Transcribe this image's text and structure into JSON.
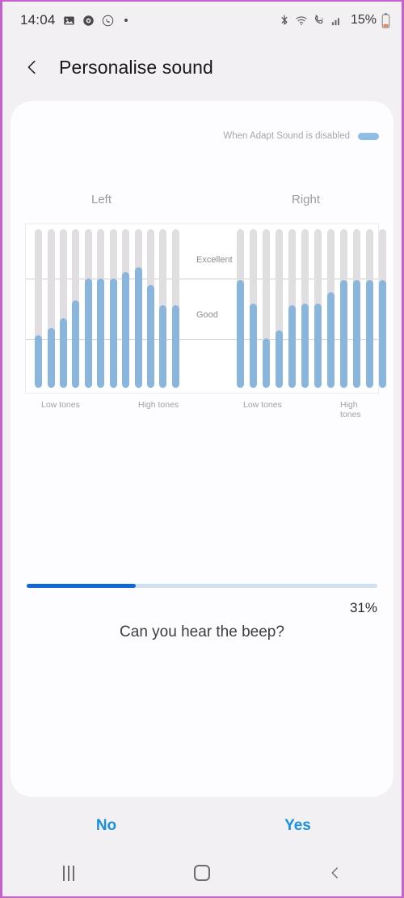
{
  "status_bar": {
    "time": "14:04",
    "left_icons": [
      "gallery-icon",
      "record-circle-icon",
      "whatsapp-icon",
      "dot-indicator"
    ],
    "right_icons": [
      "bluetooth-icon",
      "wifi-icon",
      "volte-call-icon",
      "signal-bars-icon"
    ],
    "battery_percent": "15%"
  },
  "app_bar": {
    "back_label": "back-chevron",
    "title": "Personalise sound"
  },
  "card": {
    "adapt_sound": {
      "label": "When Adapt Sound is disabled",
      "toggle_state": "on",
      "toggle_color": "#8fbde4"
    },
    "progress": {
      "percent_text": "31%",
      "percent_value": 31,
      "fill_color": "#1068d4",
      "track_color": "#cfe0f2"
    },
    "question": "Can you hear the beep?"
  },
  "answers": {
    "no_label": "No",
    "yes_label": "Yes",
    "color": "#1a91dc"
  },
  "nav_bar": {
    "recents_label": "recents-icon",
    "home_label": "home-icon",
    "back_label": "back-icon"
  },
  "chart_data": {
    "type": "bar",
    "title": "",
    "xlabel": "",
    "ylabel": "",
    "ylim": [
      0,
      100
    ],
    "grid": true,
    "grid_values": [
      68,
      32
    ],
    "quality_labels": [
      "Excellent",
      "Good"
    ],
    "tone_labels": [
      "Low tones",
      "High tones"
    ],
    "bar_track_color": "#e0dee1",
    "bar_fill_color": "#8ab6de",
    "panels": [
      {
        "name": "Left",
        "categories": [
          "f1",
          "f2",
          "f3",
          "f4",
          "f5",
          "f6",
          "f7",
          "f8",
          "f9",
          "f10",
          "f11",
          "f12"
        ],
        "values": [
          33,
          38,
          44,
          55,
          69,
          69,
          69,
          73,
          76,
          65,
          52,
          52
        ]
      },
      {
        "name": "Right",
        "categories": [
          "f1",
          "f2",
          "f3",
          "f4",
          "f5",
          "f6",
          "f7",
          "f8",
          "f9",
          "f10",
          "f11",
          "f12"
        ],
        "values": [
          68,
          53,
          31,
          36,
          52,
          53,
          53,
          60,
          68,
          68,
          68,
          68
        ]
      }
    ]
  }
}
